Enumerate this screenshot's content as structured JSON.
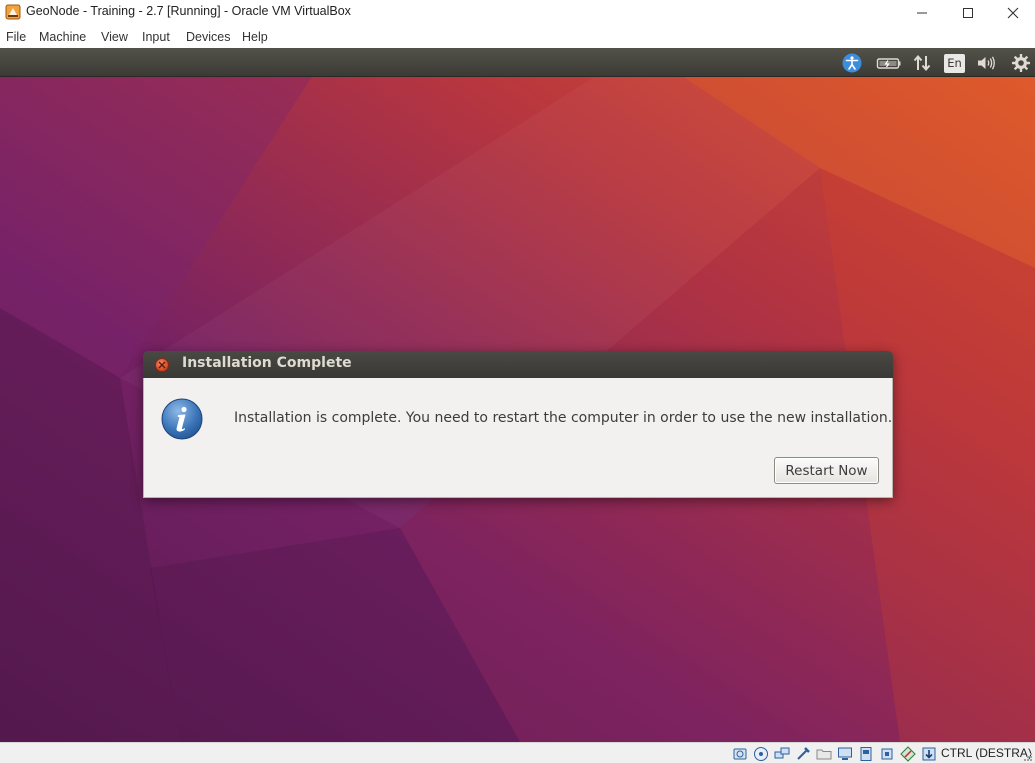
{
  "window": {
    "title": "GeoNode - Training - 2.7 [Running] - Oracle VM VirtualBox",
    "controls": [
      "minimize-icon",
      "maximize-icon",
      "close-icon"
    ]
  },
  "menubar": {
    "items": [
      "File",
      "Machine",
      "View",
      "Input",
      "Devices",
      "Help"
    ]
  },
  "guest_topbar": {
    "indicators": [
      "accessibility-icon",
      "battery-icon",
      "network-icon",
      "keyboard-layout",
      "volume-icon",
      "settings-gear-icon"
    ],
    "keyboard_layout": "En"
  },
  "dialog": {
    "title": "Installation Complete",
    "message": "Installation is complete. You need to restart the computer in order to use the new installation.",
    "icon": "info-icon",
    "button_label": "Restart Now"
  },
  "statusbar": {
    "icons": [
      "hard-disk-icon",
      "optical-drive-icon",
      "network-adapter-icon",
      "usb-icon",
      "shared-folders-icon",
      "display-icon",
      "video-capture-icon",
      "cpu-icon",
      "mouse-integration-icon",
      "keyboard-capture-icon"
    ],
    "host_key": "CTRL (DESTRA)"
  },
  "colors": {
    "desktop_purple": "#6e1f63",
    "desktop_orange": "#d6512b",
    "dialog_titlebar": "#3e3d39",
    "dialog_body": "#f2f1f0",
    "close_orange": "#e25a31"
  }
}
